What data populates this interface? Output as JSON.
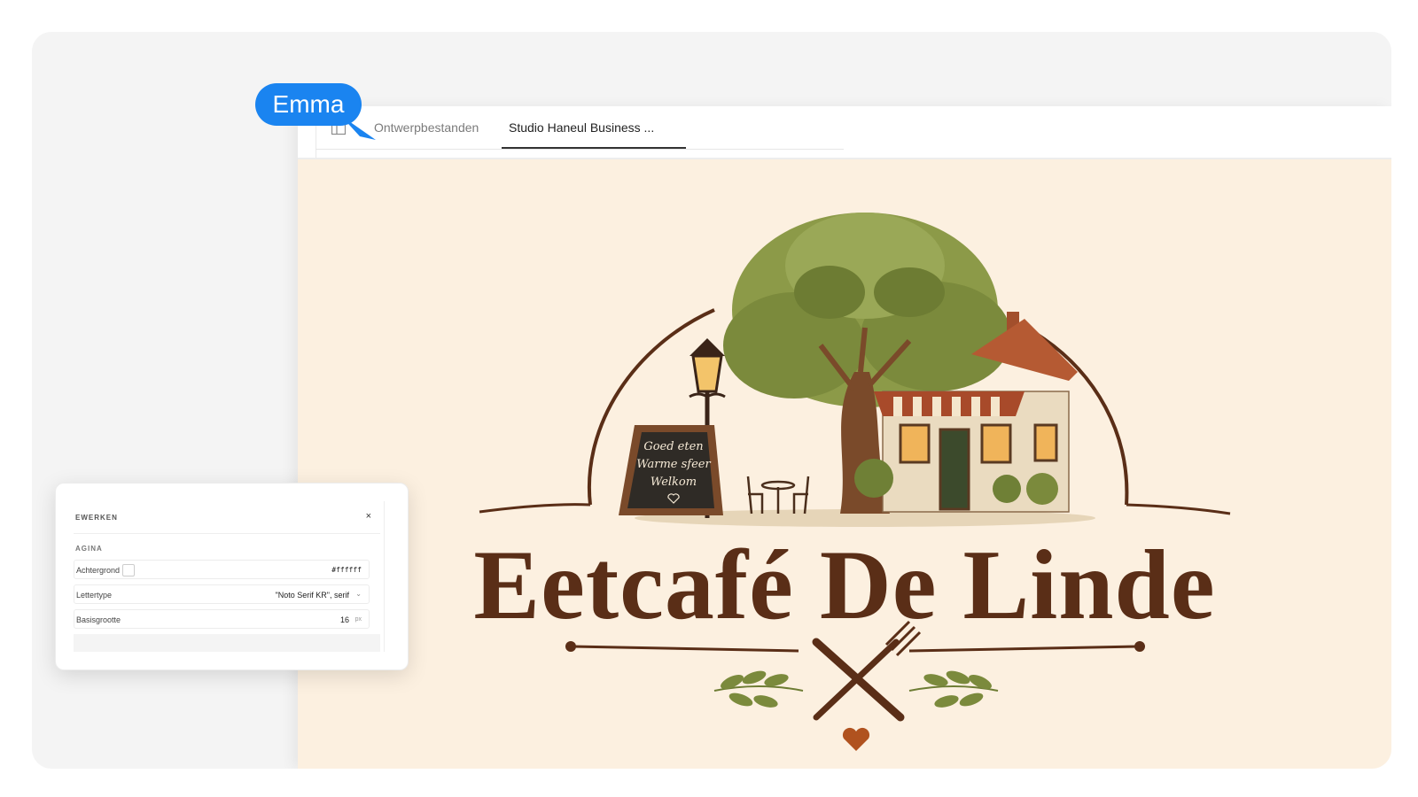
{
  "collaborator": {
    "name": "Emma",
    "color": "#1a84f0"
  },
  "tabs": [
    {
      "label": "Ontwerpbestanden",
      "active": false
    },
    {
      "label": "Studio Haneul Business ...",
      "active": true
    }
  ],
  "icons": {
    "layout": "layout-icon",
    "close": "close-icon",
    "chevron": "chevron-down-icon",
    "cursor": "cursor-arrow-icon"
  },
  "logo": {
    "title": "Eetcafé De Linde",
    "chalkboard": [
      "Goed eten",
      "Warme sfeer",
      "Welkom"
    ],
    "colors": {
      "background": "#fcf0e0",
      "brown": "#5a2e17",
      "leaf": "#7b8a3c",
      "roof": "#b55a33",
      "heart": "#b0521f"
    }
  },
  "properties_panel": {
    "title": "EWERKEN",
    "close_label": "×",
    "section": "AGINA",
    "rows": [
      {
        "label": "Achtergrond",
        "value": "#ffffff"
      },
      {
        "label": "Lettertype",
        "value": "\"Noto Serif KR\", serif"
      },
      {
        "label": "Basisgrootte",
        "value": "16",
        "unit": "px"
      }
    ]
  }
}
